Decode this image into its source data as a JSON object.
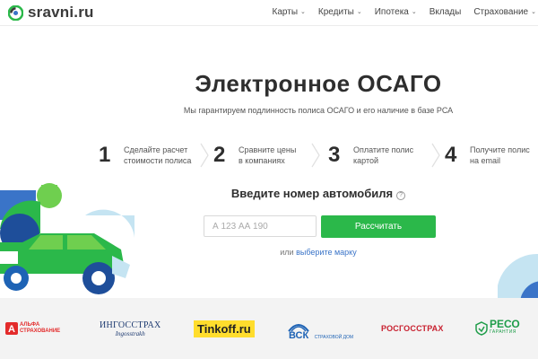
{
  "header": {
    "logo_text": "sravni.ru",
    "nav": [
      {
        "label": "Карты"
      },
      {
        "label": "Кредиты"
      },
      {
        "label": "Ипотека"
      },
      {
        "label": "Вклады"
      },
      {
        "label": "Страхование"
      }
    ]
  },
  "main": {
    "title": "Электронное ОСАГО",
    "subtitle": "Мы гарантируем подлинность полиса ОСАГО и его наличие в базе РСА",
    "steps": [
      {
        "num": "1",
        "line1": "Сделайте расчет",
        "line2": "стоимости полиса"
      },
      {
        "num": "2",
        "line1": "Сравните цены",
        "line2": "в компаниях"
      },
      {
        "num": "3",
        "line1": "Оплатите полис",
        "line2": "картой"
      },
      {
        "num": "4",
        "line1": "Получите полис",
        "line2": "на email"
      }
    ],
    "plate_label": "Введите номер автомобиля",
    "help_glyph": "?",
    "plate_placeholder": "А 123 АА 190",
    "calc_button": "Рассчитать",
    "alt_prefix": "или",
    "alt_link": "выберите марку"
  },
  "partners": [
    {
      "name": "АЛЬФА СТРАХОВАНИЕ",
      "line1": "АЛЬФА",
      "line2": "СТРАХОВАНИЕ",
      "color": "#e32b2b"
    },
    {
      "name": "ИНГОССТРАХ",
      "line1": "ИНГОССТРАХ",
      "line2": "Ingosstrakh",
      "color": "#1d3a70"
    },
    {
      "name": "Tinkoff.ru",
      "color": "#ffdd2d"
    },
    {
      "name": "ВСК",
      "line1": "ВСК",
      "line2": "СТРАХОВОЙ ДОМ",
      "color": "#1e63b5"
    },
    {
      "name": "РОСГОССТРАХ",
      "color": "#c8202f"
    },
    {
      "name": "РЕСО",
      "line1": "РЕСО",
      "line2": "ГАРАНТИЯ",
      "color": "#1f9d4a"
    }
  ],
  "colors": {
    "accent": "#2bb84a",
    "link": "#3a74c8",
    "title": "#2e2e2e"
  }
}
